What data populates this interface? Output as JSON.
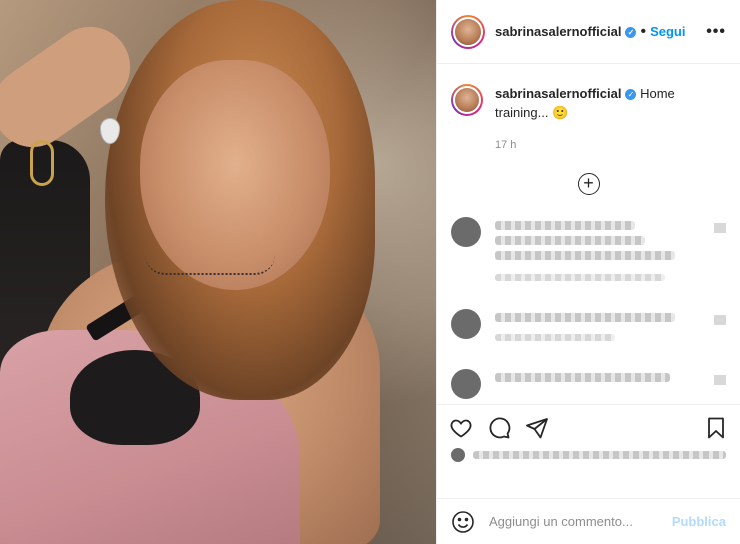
{
  "post": {
    "username": "sabrinasalernofficial",
    "follow_label": "Segui",
    "more_label": "•••",
    "separator": "•",
    "verified_mark": "✓"
  },
  "caption": {
    "username": "sabrinasalernofficial",
    "text": "Home training...",
    "emoji": "🙂",
    "time": "17 h"
  },
  "load_more": {
    "icon": "plus-circle-icon",
    "symbol": "+"
  },
  "actions": {
    "icons": [
      "heart-icon",
      "comment-icon",
      "share-icon",
      "bookmark-icon"
    ]
  },
  "add_comment": {
    "placeholder": "Aggiungi un commento...",
    "publish_label": "Pubblica",
    "icon": "emoji-icon"
  },
  "colors": {
    "link_blue": "#0095f6",
    "publish_disabled": "#b3dbff",
    "verified": "#3897f0"
  }
}
